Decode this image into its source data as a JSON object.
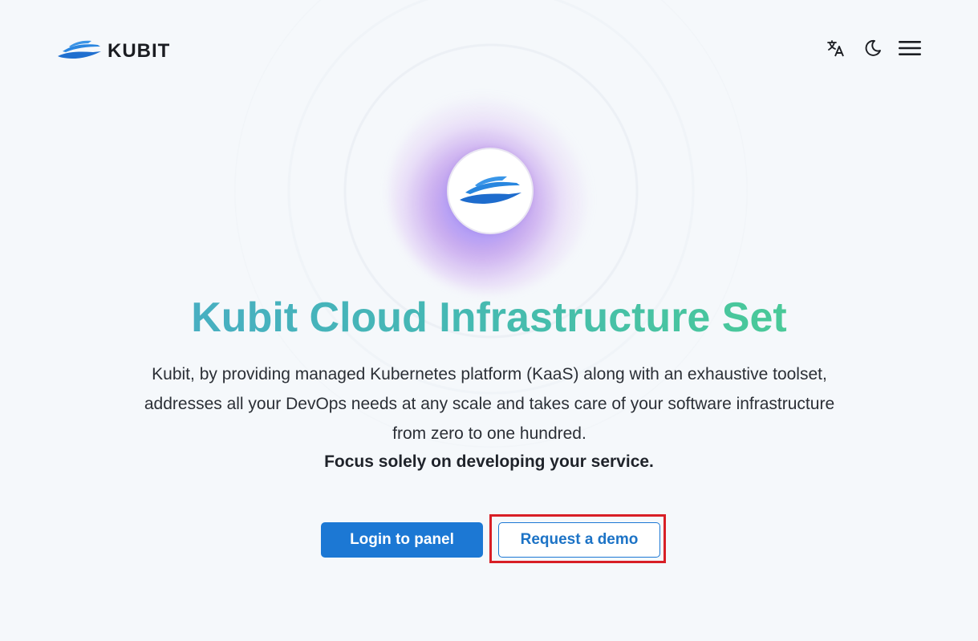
{
  "header": {
    "brand": "KUBIT",
    "icons": {
      "language": "translate-icon",
      "theme": "moon-icon",
      "menu": "hamburger-menu-icon"
    }
  },
  "hero": {
    "logo_icon": "kubit-boat-logo-icon",
    "title": "Kubit Cloud Infrastructure Set",
    "description": "Kubit, by providing managed Kubernetes platform (KaaS) along with an exhaustive toolset, addresses all your DevOps needs at any scale and takes care of your software infrastructure from zero to one hundred.",
    "emphasis": "Focus solely on developing your service."
  },
  "actions": {
    "login_label": "Login to panel",
    "demo_label": "Request a demo"
  },
  "colors": {
    "primary": "#1c78d4",
    "title_gradient_start": "#4aa8cc",
    "title_gradient_end": "#4cd389",
    "highlight": "#d81f26",
    "background": "#f5f8fb"
  }
}
